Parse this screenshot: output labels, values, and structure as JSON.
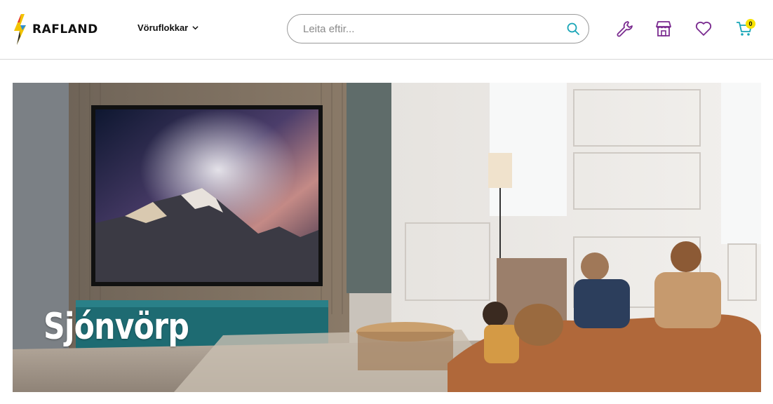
{
  "brand": {
    "name": "RAFLAND",
    "logo_icon": "lightning-bolt-icon"
  },
  "nav": {
    "categories_label": "Vöruflokkar"
  },
  "search": {
    "placeholder": "Leita eftir..."
  },
  "header_icons": [
    "wrench-icon",
    "store-icon",
    "heart-icon",
    "cart-icon"
  ],
  "cart": {
    "count": "0"
  },
  "hero": {
    "title": "Sjónvörp"
  },
  "colors": {
    "accent_purple": "#7a2b8f",
    "accent_teal": "#1aa6b7",
    "badge_yellow": "#f7e300"
  }
}
